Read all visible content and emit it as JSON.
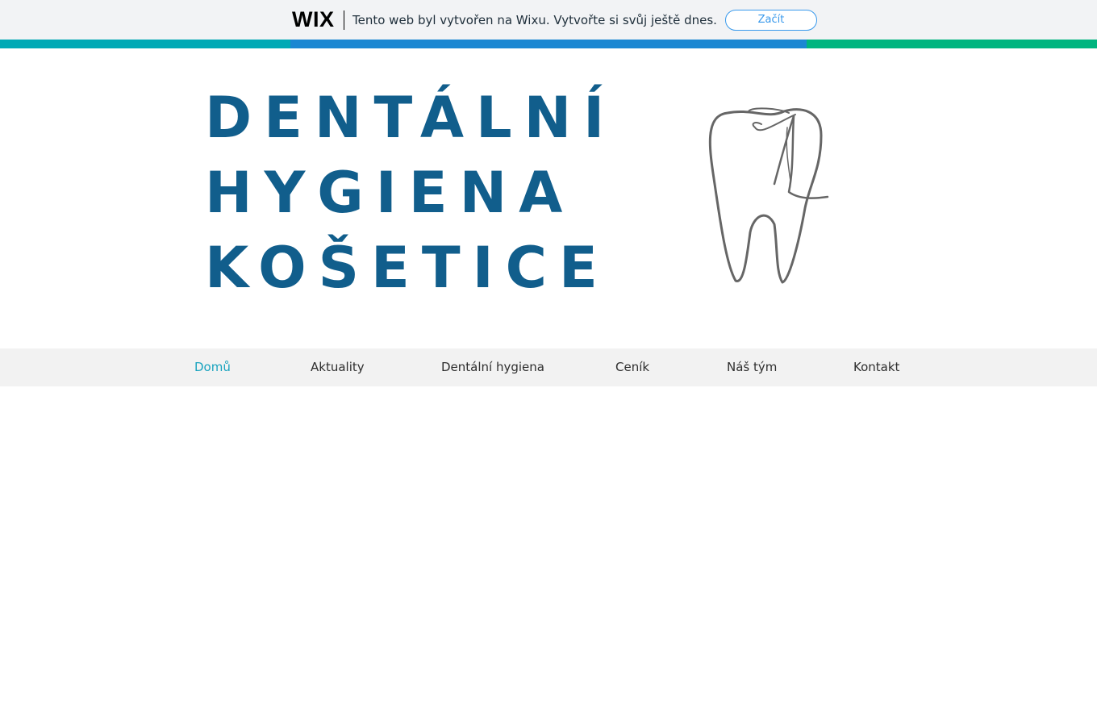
{
  "wix_banner": {
    "logo": "WIX",
    "message": "Tento web byl vytvořen na Wixu. Vytvořte si svůj ještě dnes.",
    "button_label": "Začít"
  },
  "header": {
    "title_lines": [
      "DENTÁLNÍ",
      "HYGIENA",
      "KOŠETICE"
    ],
    "logo_icon": "tooth-icon"
  },
  "nav": {
    "items": [
      {
        "label": "Domů",
        "active": true
      },
      {
        "label": "Aktuality",
        "active": false
      },
      {
        "label": "Dentální hygiena",
        "active": false
      },
      {
        "label": "Ceník",
        "active": false
      },
      {
        "label": "Náš tým",
        "active": false
      },
      {
        "label": "Kontakt",
        "active": false
      }
    ]
  },
  "colors": {
    "brand_blue": "#115e8c",
    "nav_active": "#1aa4bf",
    "stripe_teal": "#00a9b5",
    "stripe_blue": "#1b87d2",
    "stripe_green": "#00b57f"
  }
}
